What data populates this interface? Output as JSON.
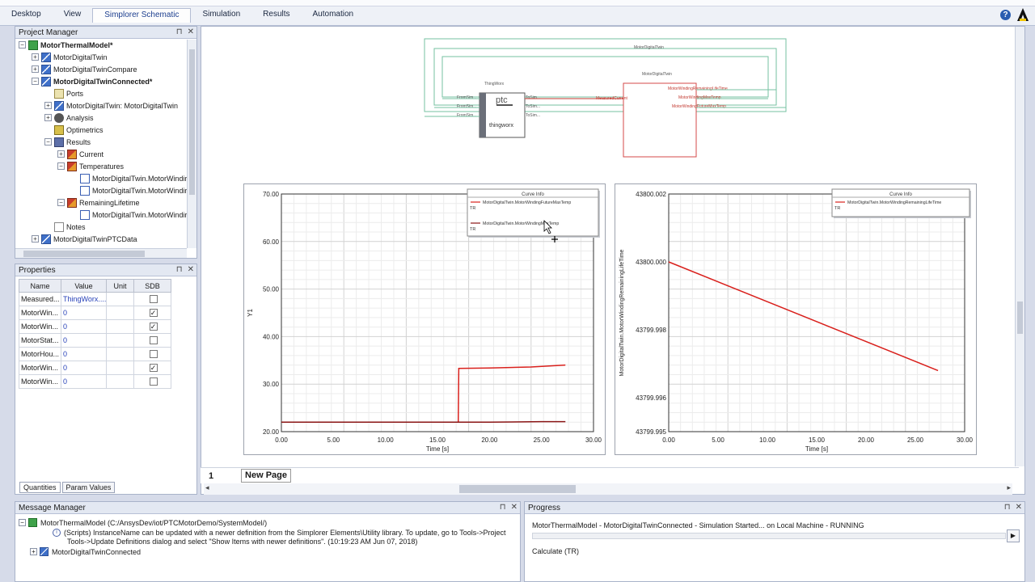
{
  "menu": {
    "tabs": [
      "Desktop",
      "View",
      "Simplorer Schematic",
      "Simulation",
      "Results",
      "Automation"
    ],
    "active_index": 2
  },
  "project_manager": {
    "title": "Project Manager",
    "items": [
      {
        "label": "MotorThermalModel*",
        "icon": "project-icon",
        "bold": true
      },
      {
        "label": "MotorDigitalTwin",
        "icon": "design-icon"
      },
      {
        "label": "MotorDigitalTwinCompare",
        "icon": "design-icon"
      },
      {
        "label": "MotorDigitalTwinConnected*",
        "icon": "design-icon",
        "bold": true
      },
      {
        "label": "Ports",
        "icon": "folder-icon"
      },
      {
        "label": "MotorDigitalTwin: MotorDigitalTwin",
        "icon": "design-icon"
      },
      {
        "label": "Analysis",
        "icon": "gear-icon"
      },
      {
        "label": "Optimetrics",
        "icon": "optimetrics-icon"
      },
      {
        "label": "Results",
        "icon": "results-icon"
      },
      {
        "label": "Current",
        "icon": "current-report-icon"
      },
      {
        "label": "Temperatures",
        "icon": "temperature-report-icon"
      },
      {
        "label": "MotorDigitalTwin.MotorWindir",
        "icon": "plot-icon"
      },
      {
        "label": "MotorDigitalTwin.MotorWindir",
        "icon": "plot-icon"
      },
      {
        "label": "RemainingLifetime",
        "icon": "lifetime-report-icon"
      },
      {
        "label": "MotorDigitalTwin.MotorWindir",
        "icon": "plot-icon"
      },
      {
        "label": "Notes",
        "icon": "notes-icon"
      },
      {
        "label": "MotorDigitalTwinPTCData",
        "icon": "design-icon"
      }
    ]
  },
  "properties": {
    "title": "Properties",
    "columns": [
      "Name",
      "Value",
      "Unit",
      "SDB"
    ],
    "rows": [
      {
        "name": "Measured...",
        "value": "ThingWorx....",
        "unit": "",
        "sdb": ""
      },
      {
        "name": "MotorWin...",
        "value": "0",
        "unit": "",
        "sdb": "✓"
      },
      {
        "name": "MotorWin...",
        "value": "0",
        "unit": "",
        "sdb": "✓"
      },
      {
        "name": "MotorStat...",
        "value": "0",
        "unit": "",
        "sdb": ""
      },
      {
        "name": "MotorHou...",
        "value": "0",
        "unit": "",
        "sdb": ""
      },
      {
        "name": "MotorWin...",
        "value": "0",
        "unit": "",
        "sdb": "✓"
      },
      {
        "name": "MotorWin...",
        "value": "0",
        "unit": "",
        "sdb": ""
      }
    ],
    "tabs": [
      "Quantities",
      "Param Values"
    ]
  },
  "schematic": {
    "outer_label": "MotorDigitalTwin",
    "inner_label": "MotorDigitalTwin",
    "thingworx_label": "ThingWorx",
    "ptc_text": "ptc",
    "thingworx_text": "thingworx",
    "measured_current": "MeasuredCurrent",
    "out1": "MotorWindingRemainingLifeTime",
    "out2": "MotorWindingMaxTemp",
    "out3": "MotorWindingFutureMaxTemp",
    "in_ports": [
      "FromSim...",
      "FromSim...",
      "FromSim..."
    ],
    "out_ports": [
      "ToSim...",
      "ToSim...",
      "ToSim..."
    ]
  },
  "page": {
    "number": "1",
    "tab_label": "New Page"
  },
  "message_manager": {
    "title": "Message Manager",
    "project_line": "MotorThermalModel (C:/AnsysDev/iot/PTCMotorDemo/SystemModel/)",
    "info_line1": "(Scripts) InstanceName can be updated with a newer definition from the Simplorer Elements\\Utility library.  To update, go to Tools->Project",
    "info_line2": "Tools->Update Definitions dialog and select \"Show Items with newer definitions\".  (10:19:23 AM  Jun 07, 2018)",
    "design_line": "MotorDigitalTwinConnected"
  },
  "progress": {
    "title": "Progress",
    "status": "MotorThermalModel - MotorDigitalTwinConnected - Simulation Started... on Local Machine - RUNNING",
    "calc": "Calculate (TR)"
  },
  "chart_data": [
    {
      "type": "line",
      "legend_title": "Curve Info",
      "ylabel": "Y1",
      "xlabel": "Time [s]",
      "xlim": [
        0,
        30
      ],
      "ylim": [
        20,
        70
      ],
      "x_ticks": [
        "0.00",
        "5.00",
        "10.00",
        "15.00",
        "20.00",
        "25.00",
        "30.00"
      ],
      "y_ticks": [
        "20.00",
        "30.00",
        "40.00",
        "50.00",
        "60.00",
        "70.00"
      ],
      "series": [
        {
          "name": "MotorDigitalTwin.MotorWindingFutureMaxTemp",
          "tag": "TR",
          "color": "#d9201c",
          "x": [
            0,
            17.0,
            17.05,
            20,
            24,
            27.3
          ],
          "y": [
            22,
            22,
            33.3,
            33.4,
            33.6,
            34.0
          ]
        },
        {
          "name": "MotorDigitalTwin.MotorWindingMaxTemp",
          "tag": "TR",
          "color": "#8a1515",
          "x": [
            0,
            5,
            10,
            15,
            20,
            25,
            27.3
          ],
          "y": [
            22,
            22,
            22,
            22,
            22,
            22.1,
            22.1
          ]
        }
      ],
      "legend": "top-right",
      "grid": true
    },
    {
      "type": "line",
      "ylabel": "MotorDigitalTwin.MotorWindingRemainingLifeTime",
      "xlabel": "Time [s]",
      "xlim": [
        0,
        30
      ],
      "ylim": [
        43799.995,
        43800.002
      ],
      "x_ticks": [
        "0.00",
        "5.00",
        "10.00",
        "15.00",
        "20.00",
        "25.00",
        "30.00"
      ],
      "y_ticks": [
        "43799.995",
        "43799.996",
        "43799.998",
        "43800.000",
        "43800.002"
      ],
      "series": [
        {
          "name": "MotorDigitalTwin.MotorWindingRemainingLifeTime",
          "tag": "TR",
          "color": "#d9201c",
          "x": [
            0,
            27.3
          ],
          "y": [
            43800.0,
            43799.9968
          ]
        }
      ],
      "legend": "top-right",
      "grid": true
    }
  ]
}
